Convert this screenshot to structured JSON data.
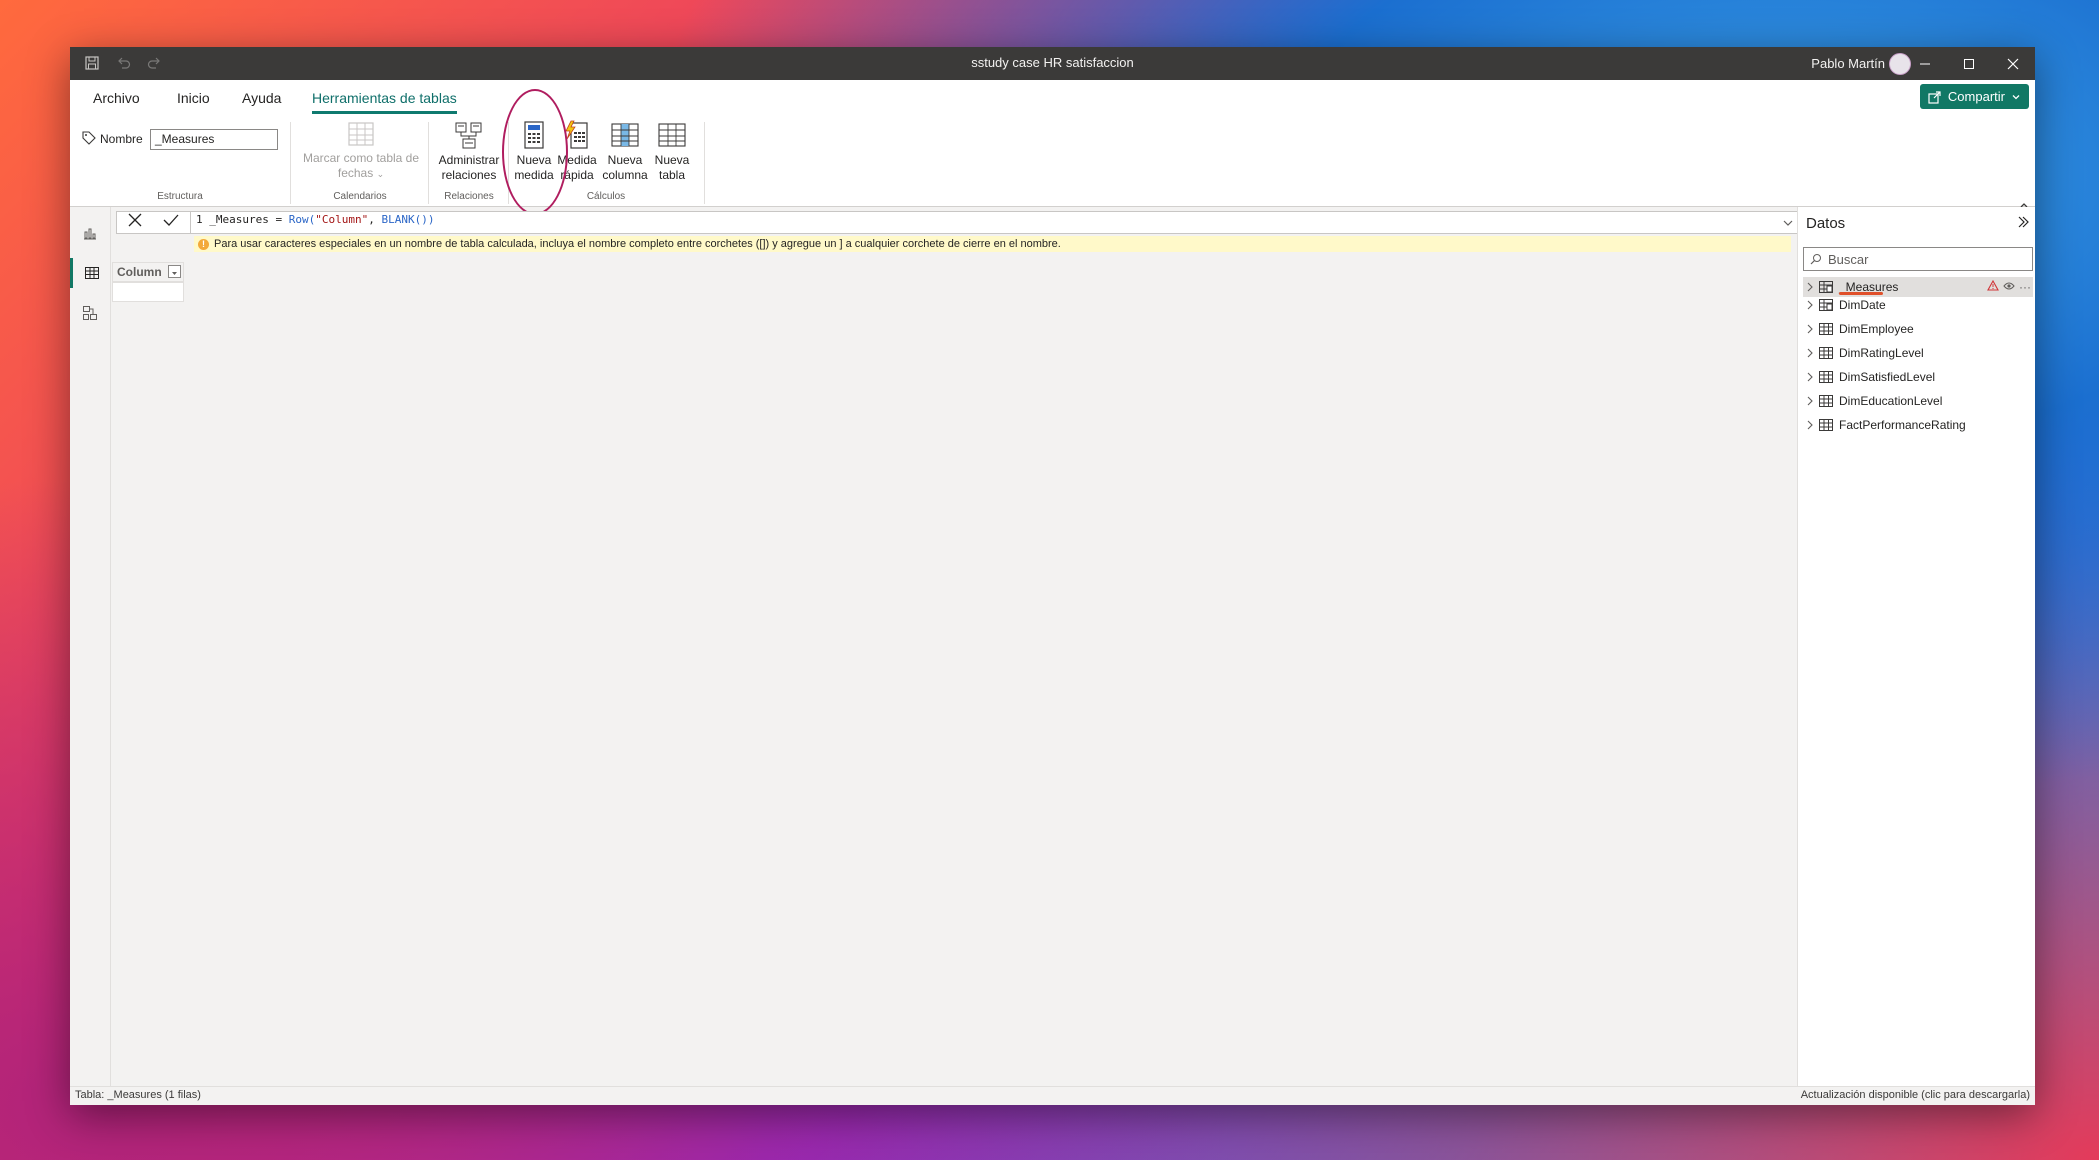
{
  "window": {
    "title": "sstudy case HR satisfaccion",
    "user": "Pablo Martín"
  },
  "tabs": [
    {
      "label": "Archivo"
    },
    {
      "label": "Inicio"
    },
    {
      "label": "Ayuda"
    },
    {
      "label": "Herramientas de tablas",
      "active": true
    }
  ],
  "share": {
    "label": "Compartir"
  },
  "ribbon": {
    "name_label": "Nombre",
    "name_value": "_Measures",
    "groups": {
      "estructura": "Estructura",
      "calendarios": "Calendarios",
      "relaciones": "Relaciones",
      "calculos": "Cálculos"
    },
    "buttons": {
      "marcar_line1": "Marcar como tabla de",
      "marcar_line2": "fechas",
      "admin_line1": "Administrar",
      "admin_line2": "relaciones",
      "nueva_medida_line1": "Nueva",
      "nueva_medida_line2": "medida",
      "medida_rapida_line1": "Medida",
      "medida_rapida_line2": "rápida",
      "nueva_columna_line1": "Nueva",
      "nueva_columna_line2": "columna",
      "nueva_tabla_line1": "Nueva",
      "nueva_tabla_line2": "tabla"
    }
  },
  "formula": {
    "line_number": "1",
    "prefix": "_Measures = ",
    "fn1": "Row(",
    "str1": "\"Column\"",
    "mid": ", ",
    "fn2": "BLANK())",
    "warning": "Para usar caracteres especiales en un nombre de tabla calculada, incluya el nombre completo entre corchetes ([]) y agregue un ] a cualquier corchete de cierre en el nombre."
  },
  "grid": {
    "column_header": "Column"
  },
  "data_pane": {
    "title": "Datos",
    "search_placeholder": "Buscar",
    "items": [
      {
        "label": "_Measures"
      },
      {
        "label": "DimDate"
      },
      {
        "label": "DimEmployee"
      },
      {
        "label": "DimRatingLevel"
      },
      {
        "label": "DimSatisfiedLevel"
      },
      {
        "label": "DimEducationLevel"
      },
      {
        "label": "FactPerformanceRating"
      }
    ]
  },
  "status": {
    "left": "Tabla: _Measures (1 filas)",
    "right": "Actualización disponible (clic para descargarla)"
  },
  "colors": {
    "accent": "#117865",
    "titlebar": "#3b3a39",
    "highlight_circle": "#b01d5f",
    "warning_bg": "#fff9c9"
  }
}
